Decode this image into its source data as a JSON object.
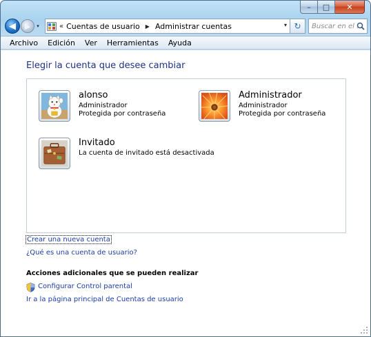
{
  "window": {
    "caption_buttons": {
      "minimize": "–",
      "maximize": "□",
      "close": "✕"
    }
  },
  "navbar": {
    "back_glyph": "◀",
    "forward_glyph": "▶",
    "dropdown_glyph": "▾",
    "address": {
      "crumb_separator": "«",
      "crumbs": [
        "Cuentas de usuario",
        "Administrar cuentas"
      ],
      "arrow": "▶",
      "dropdown": "▾"
    },
    "refresh_glyph": "↻",
    "search_placeholder": "Buscar en el ..."
  },
  "menu": {
    "items": [
      "Archivo",
      "Edición",
      "Ver",
      "Herramientas",
      "Ayuda"
    ]
  },
  "main": {
    "heading": "Elegir la cuenta que desee cambiar",
    "accounts": [
      {
        "name": "alonso",
        "type": "Administrador",
        "status": "Protegida por contraseña",
        "icon": "lucky-cat-icon"
      },
      {
        "name": "Administrador",
        "type": "Administrador",
        "status": "Protegida por contraseña",
        "icon": "orange-flower-icon"
      },
      {
        "name": "Invitado",
        "status": "La cuenta de invitado está desactivada",
        "icon": "suitcase-icon"
      }
    ],
    "links": {
      "create_account": "Crear una nueva cuenta",
      "what_is_account": "¿Qué es una cuenta de usuario?"
    },
    "additional_actions": {
      "title": "Acciones adicionales que se pueden realizar",
      "parental_control": "Configurar Control parental",
      "home_page": "Ir a la página principal de Cuentas de usuario"
    }
  },
  "colors": {
    "link": "#1a3ea6",
    "heading": "#1e3287",
    "frame": "#a9d3ef",
    "close_button": "#c8401b"
  }
}
